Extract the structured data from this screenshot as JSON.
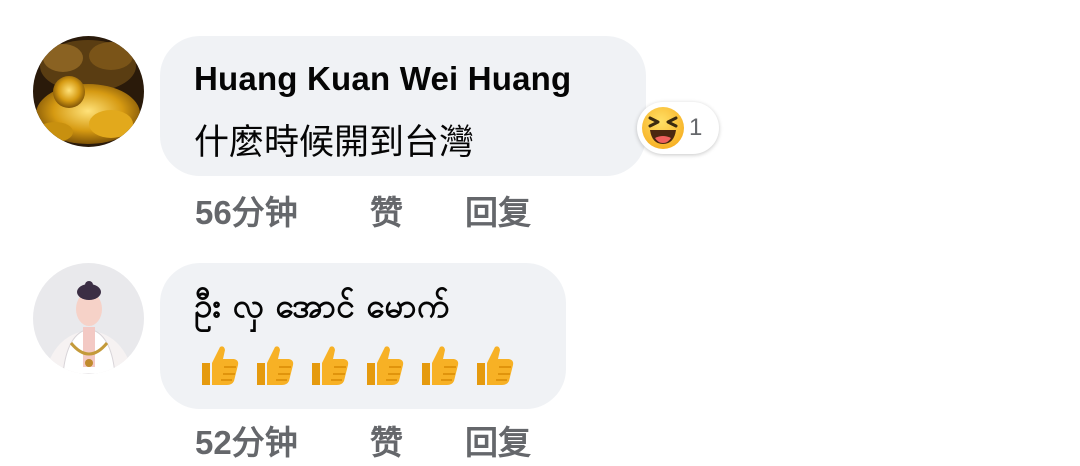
{
  "comments": [
    {
      "author": "Huang Kuan Wei Huang",
      "text": "什麼時候開到台灣",
      "reaction": {
        "icon": "laughing-emoji-icon",
        "count": "1"
      },
      "time": "56分钟",
      "like_label": "赞",
      "reply_label": "回复"
    },
    {
      "author": "ဦး လှ အောင် မောက်",
      "text": "",
      "emojis": [
        "thumbs-up-icon",
        "thumbs-up-icon",
        "thumbs-up-icon",
        "thumbs-up-icon",
        "thumbs-up-icon",
        "thumbs-up-icon"
      ],
      "time": "52分钟",
      "like_label": "赞",
      "reply_label": "回复"
    }
  ],
  "colors": {
    "bubble": "#f0f2f5",
    "meta_text": "#65676b",
    "primary_text": "#050505",
    "emoji_yellow": "#f7b125"
  }
}
